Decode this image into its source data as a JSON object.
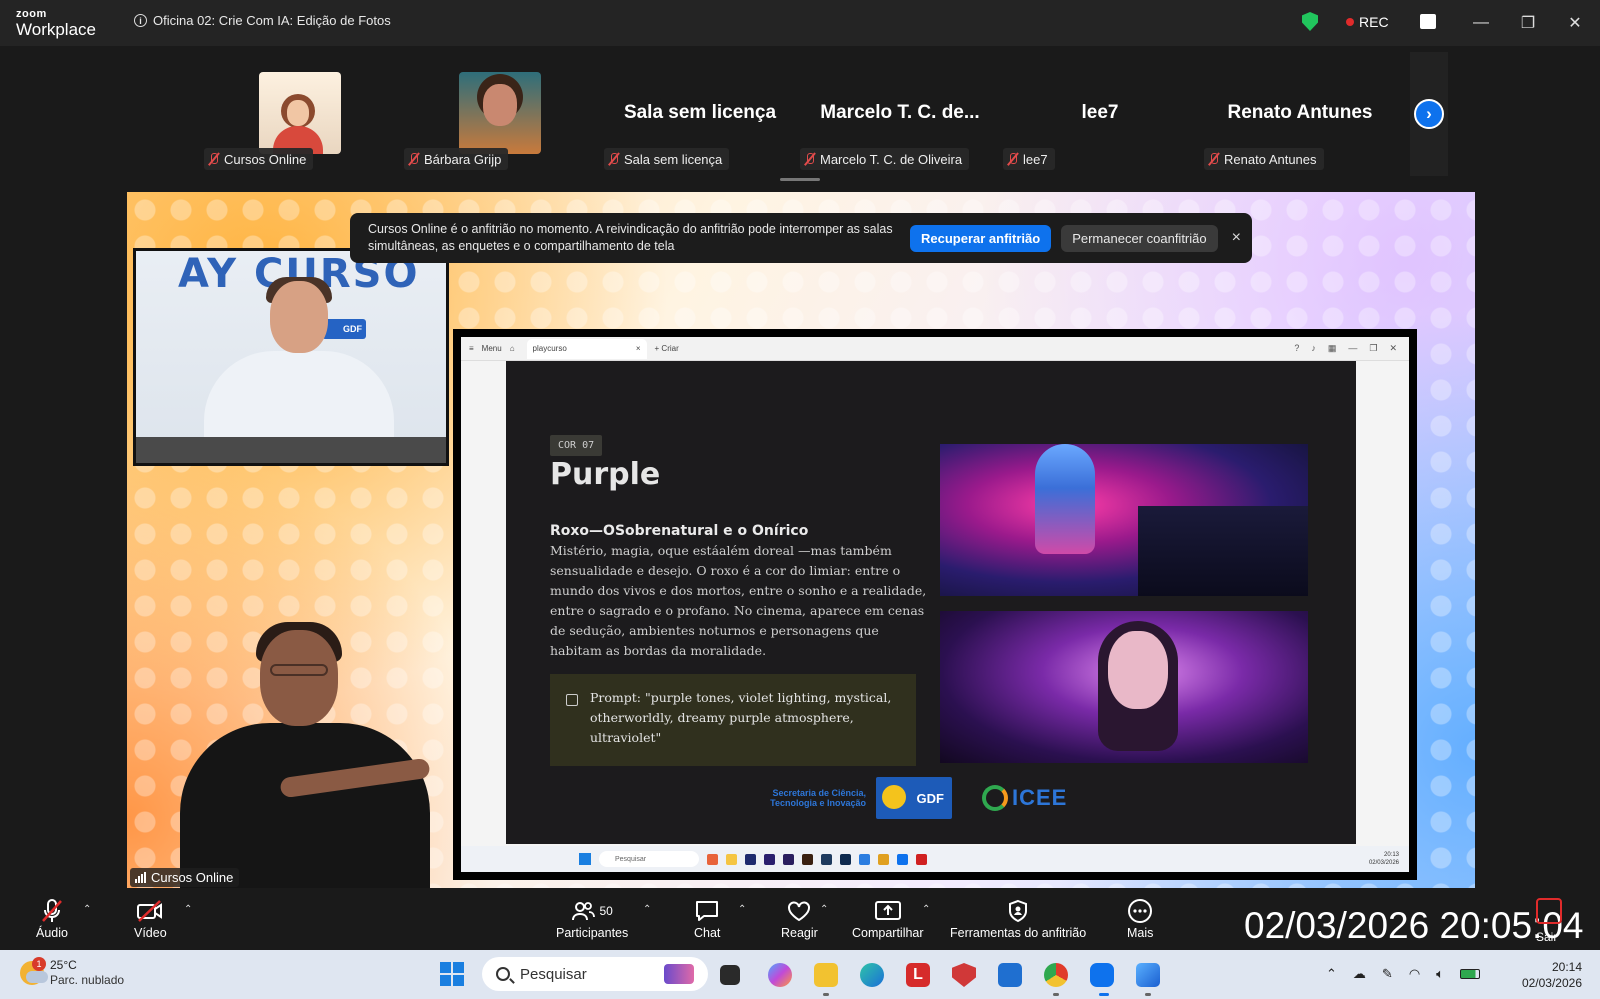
{
  "window": {
    "brand_top": "zoom",
    "brand_bottom": "Workplace",
    "meeting_title": "Oficina 02: Crie Com IA: Edição de Fotos",
    "rec_label": "REC",
    "colors": {
      "titlebar": "#242424",
      "accent_blue": "#0e72ed",
      "rec_red": "#e02b2b",
      "shield_green": "#21c55d"
    }
  },
  "gallery": {
    "participants": [
      {
        "name": "Cursos Online",
        "display": "",
        "type": "avatar",
        "muted": true
      },
      {
        "name": "Bárbara Grijp",
        "display": "",
        "type": "photo",
        "muted": true
      },
      {
        "name": "Sala sem licença",
        "display": "Sala sem licença",
        "type": "text",
        "muted": true
      },
      {
        "name": "Marcelo T. C. de  Oliveira",
        "display": "Marcelo T. C. de...",
        "type": "text",
        "muted": true
      },
      {
        "name": "lee7",
        "display": "lee7",
        "type": "text",
        "muted": true
      },
      {
        "name": "Renato Antunes",
        "display": "Renato Antunes",
        "type": "text",
        "muted": true
      }
    ],
    "next_icon": "chevron-right-icon"
  },
  "host_banner": {
    "message": "Cursos Online é o anfitrião no momento. A reivindicação do anfitrião pode interromper as salas simultâneas, as enquetes e o compartilhamento de tela",
    "primary_button": "Recuperar anfitrião",
    "secondary_button": "Permanecer coanfitrião",
    "close": "×"
  },
  "videos": {
    "instructor_wall_text": "AY CURSO",
    "instructor_logo": "GDF",
    "interpreter_name": "Cursos Online"
  },
  "shared_screen": {
    "browser": {
      "menu": "Menu",
      "tab_title": "playcurso",
      "tab_close": "×",
      "new_tab": "+ Criar"
    },
    "slide": {
      "badge": "COR 07",
      "title": "Purple",
      "subtitle": "Roxo—OSobrenatural e o Onírico",
      "body": "Mistério, magia, oque estáalém doreal —mas também sensualidade e desejo. O roxo é a cor do limiar: entre o mundo dos vivos e dos mortos, entre o sonho e a realidade, entre o sagrado e o profano. No cinema, aparece em cenas de sedução, ambientes noturnos e personagens que habitam as bordas da moralidade.",
      "prompt": "Prompt: \"purple tones, violet lighting, mystical, otherworldly, dreamy purple atmosphere, ultraviolet\"",
      "secretaria": "Secretaria de Ciência, Tecnologia e Inovação",
      "gdf": "GDF",
      "icee": "ICEE"
    },
    "taskbar": {
      "search": "Pesquisar",
      "time": "20:13",
      "date": "02/03/2026"
    }
  },
  "toolbar": {
    "audio": "Áudio",
    "video": "Vídeo",
    "participants": "Participantes",
    "participant_count": "50",
    "chat": "Chat",
    "react": "Reagir",
    "share": "Compartilhar",
    "host_tools": "Ferramentas do anfitrião",
    "more": "Mais",
    "leave": "Sair"
  },
  "overlay_timestamp": "02/03/2026 20:05:04",
  "os_taskbar": {
    "weather_badge": "1",
    "temperature": "25°C",
    "condition": "Parc. nublado",
    "search_placeholder": "Pesquisar",
    "time": "20:14",
    "date": "02/03/2026"
  }
}
